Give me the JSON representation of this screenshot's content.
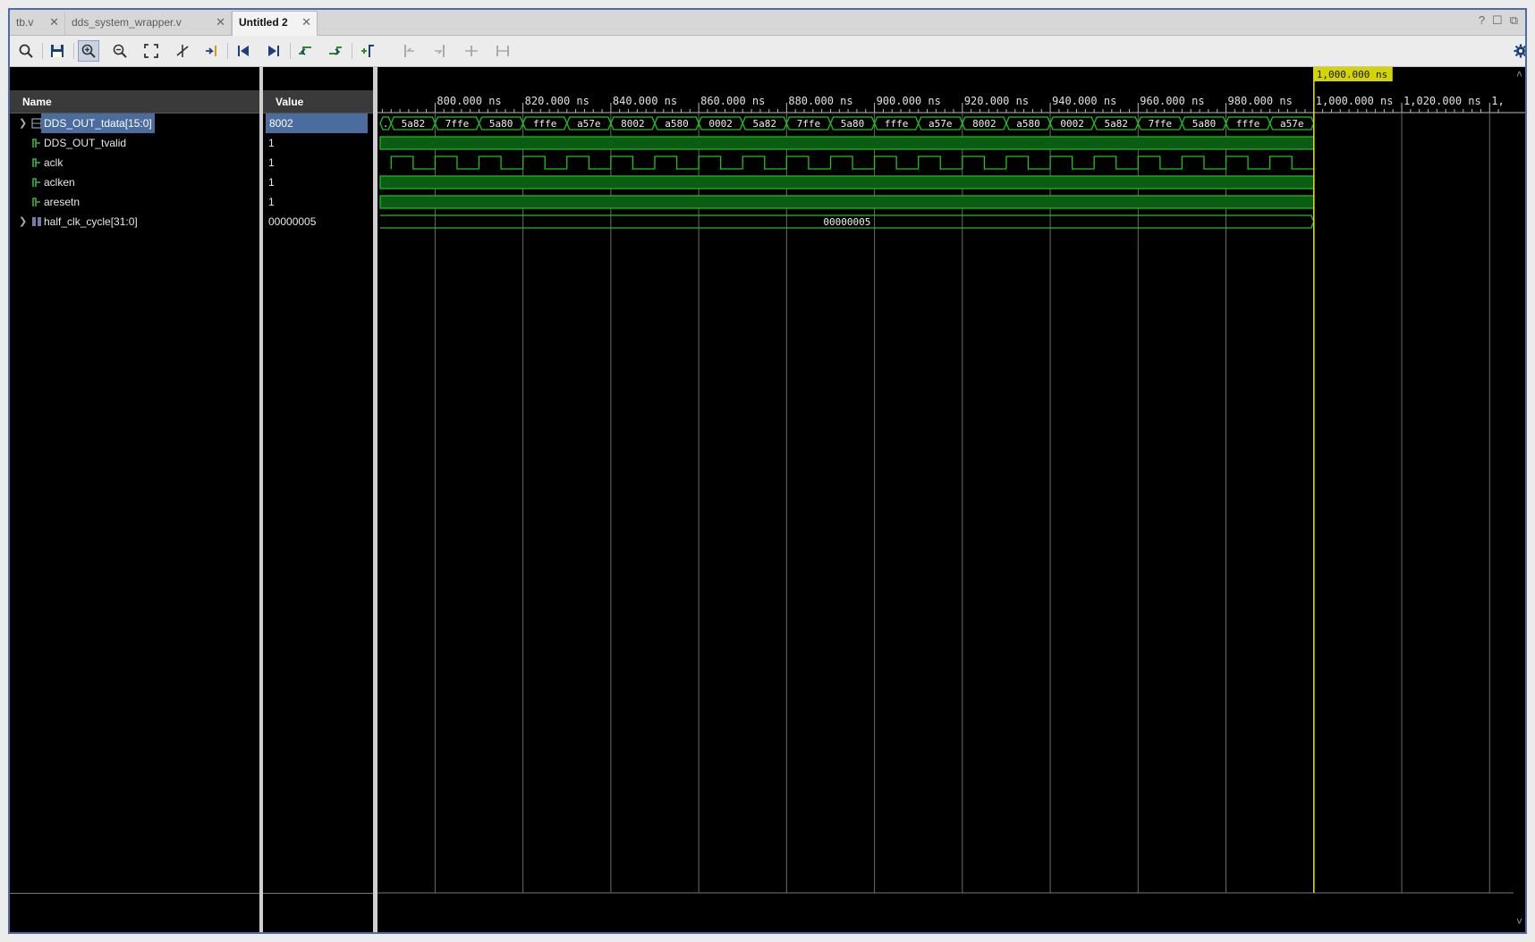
{
  "tabs": [
    {
      "label": "tb.v",
      "active": false
    },
    {
      "label": "dds_system_wrapper.v",
      "active": false
    },
    {
      "label": "Untitled 2",
      "active": true
    }
  ],
  "window_controls": [
    "help-icon",
    "maximize-icon",
    "restore-icon"
  ],
  "toolbar": {
    "buttons": [
      "search-icon",
      "save-icon",
      "zoom-in-icon",
      "zoom-out-icon",
      "zoom-fit-icon",
      "go-to-cursor-icon",
      "cursor-to-marker-icon",
      "go-to-time-zero-icon",
      "go-to-last-time-icon",
      "previous-transition-icon",
      "next-transition-icon",
      "add-marker-icon",
      "previous-marker-icon",
      "next-marker-icon",
      "swap-cursors-icon",
      "fix-cursor-icon",
      "floating-ruler-icon"
    ],
    "settings_icon": "gear-icon"
  },
  "columns": {
    "name": "Name",
    "value": "Value"
  },
  "signals": [
    {
      "name": "DDS_OUT_tdata[15:0]",
      "value": "8002",
      "expandable": true,
      "kind": "bus",
      "selected": true
    },
    {
      "name": "DDS_OUT_tvalid",
      "value": "1",
      "expandable": false,
      "kind": "bit",
      "selected": false
    },
    {
      "name": "aclk",
      "value": "1",
      "expandable": false,
      "kind": "bit",
      "selected": false
    },
    {
      "name": "aclken",
      "value": "1",
      "expandable": false,
      "kind": "bit",
      "selected": false
    },
    {
      "name": "aresetn",
      "value": "1",
      "expandable": false,
      "kind": "bit",
      "selected": false
    },
    {
      "name": "half_clk_cycle[31:0]",
      "value": "00000005",
      "expandable": true,
      "kind": "bus",
      "selected": false
    }
  ],
  "timeline": {
    "start_ns": 787.5,
    "end_ns": 1043.0,
    "tick_labels": [
      "800.000 ns",
      "820.000 ns",
      "840.000 ns",
      "860.000 ns",
      "880.000 ns",
      "900.000 ns",
      "920.000 ns",
      "940.000 ns",
      "960.000 ns",
      "980.000 ns",
      "1,000.000 ns",
      "1,020.000 ns",
      "1,"
    ],
    "tick_values_ns": [
      800,
      820,
      840,
      860,
      880,
      900,
      920,
      940,
      960,
      980,
      1000,
      1020,
      1040
    ],
    "cursor_ns": 1000,
    "cursor_label": "1,000.000 ns",
    "sim_end_ns": 1000,
    "clock_period_ns": 10
  },
  "waves": {
    "tdata_segments": [
      {
        "start": 787.5,
        "end": 790,
        "label": "."
      },
      {
        "start": 790,
        "end": 800,
        "label": "5a82"
      },
      {
        "start": 800,
        "end": 810,
        "label": "7ffe"
      },
      {
        "start": 810,
        "end": 820,
        "label": "5a80"
      },
      {
        "start": 820,
        "end": 830,
        "label": "fffe"
      },
      {
        "start": 830,
        "end": 840,
        "label": "a57e"
      },
      {
        "start": 840,
        "end": 850,
        "label": "8002"
      },
      {
        "start": 850,
        "end": 860,
        "label": "a580"
      },
      {
        "start": 860,
        "end": 870,
        "label": "0002"
      },
      {
        "start": 870,
        "end": 880,
        "label": "5a82"
      },
      {
        "start": 880,
        "end": 890,
        "label": "7ffe"
      },
      {
        "start": 890,
        "end": 900,
        "label": "5a80"
      },
      {
        "start": 900,
        "end": 910,
        "label": "fffe"
      },
      {
        "start": 910,
        "end": 920,
        "label": "a57e"
      },
      {
        "start": 920,
        "end": 930,
        "label": "8002"
      },
      {
        "start": 930,
        "end": 940,
        "label": "a580"
      },
      {
        "start": 940,
        "end": 950,
        "label": "0002"
      },
      {
        "start": 950,
        "end": 960,
        "label": "5a82"
      },
      {
        "start": 960,
        "end": 970,
        "label": "7ffe"
      },
      {
        "start": 970,
        "end": 980,
        "label": "5a80"
      },
      {
        "start": 980,
        "end": 990,
        "label": "fffe"
      },
      {
        "start": 990,
        "end": 1000,
        "label": "a57e"
      }
    ],
    "half_clk_cycle_label": "00000005",
    "color": "#22c022",
    "fill_color": "#0b5d13",
    "cursor_color": "#e6e600"
  }
}
